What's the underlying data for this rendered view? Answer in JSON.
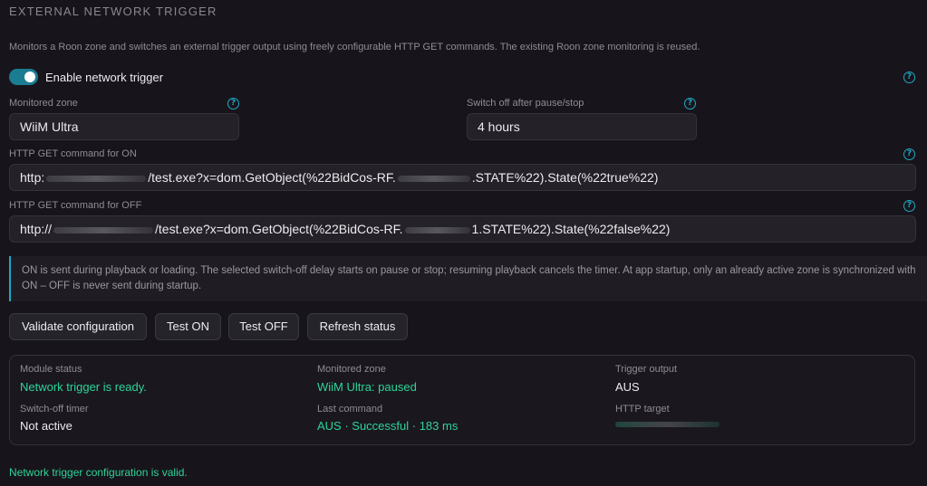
{
  "section": {
    "title": "EXTERNAL NETWORK TRIGGER",
    "description": "Monitors a Roon zone and switches an external trigger output using freely configurable HTTP GET commands. The existing Roon zone monitoring is reused."
  },
  "toggle": {
    "label": "Enable network trigger",
    "checked": true
  },
  "zone": {
    "label": "Monitored zone",
    "value": "WiiM Ultra"
  },
  "switch_off": {
    "label": "Switch off after pause/stop",
    "value": "4 hours"
  },
  "http_on": {
    "label": "HTTP GET command for ON",
    "prefix": "http:",
    "middle": "/test.exe?x=dom.GetObject(%22BidCos-RF.",
    "suffix": ".STATE%22).State(%22true%22)"
  },
  "http_off": {
    "label": "HTTP GET command for OFF",
    "prefix": "http://",
    "middle": "/test.exe?x=dom.GetObject(%22BidCos-RF.",
    "suffix": "1.STATE%22).State(%22false%22)"
  },
  "info": "ON is sent during playback or loading. The selected switch-off delay starts on pause or stop; resuming playback cancels the timer. At app startup, only an already active zone is synchronized with ON – OFF is never sent during startup.",
  "buttons": {
    "validate": "Validate configuration",
    "test_on": "Test ON",
    "test_off": "Test OFF",
    "refresh": "Refresh status"
  },
  "status": {
    "module_label": "Module status",
    "module_value": "Network trigger is ready.",
    "zone_label": "Monitored zone",
    "zone_value": "WiiM Ultra: paused",
    "output_label": "Trigger output",
    "output_value": "AUS",
    "timer_label": "Switch-off timer",
    "timer_value": "Not active",
    "last_label": "Last command",
    "last_value": "AUS · Successful · 183 ms",
    "target_label": "HTTP target"
  },
  "footer": "Network trigger configuration is valid.",
  "colors": {
    "accent": "#1fa8c4",
    "success": "#2ed399",
    "background": "#17151b"
  }
}
